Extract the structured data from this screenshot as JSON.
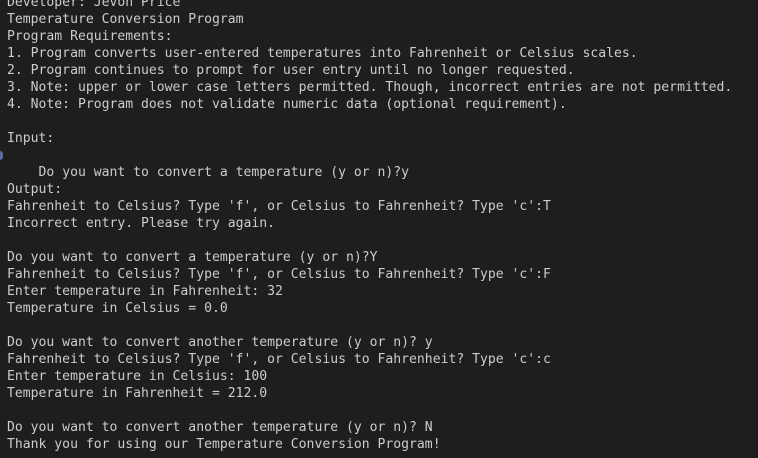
{
  "terminal": {
    "lines": [
      "Developer: Jevon Price",
      "Temperature Conversion Program",
      "Program Requirements:",
      "1. Program converts user-entered temperatures into Fahrenheit or Celsius scales.",
      "2. Program continues to prompt for user entry until no longer requested.",
      "3. Note: upper or lower case letters permitted. Though, incorrect entries are not permitted.",
      "4. Note: Program does not validate numeric data (optional requirement).",
      "",
      "Input:",
      "Do you want to convert a temperature (y or n)?y",
      "",
      "Output:",
      "Fahrenheit to Celsius? Type 'f', or Celsius to Fahrenheit? Type 'c':T",
      "Incorrect entry. Please try again.",
      "",
      "Do you want to convert a temperature (y or n)?Y",
      "Fahrenheit to Celsius? Type 'f', or Celsius to Fahrenheit? Type 'c':F",
      "Enter temperature in Fahrenheit: 32",
      "Temperature in Celsius = 0.0",
      "",
      "Do you want to convert another temperature (y or n)? y",
      "Fahrenheit to Celsius? Type 'f', or Celsius to Fahrenheit? Type 'c':c",
      "Enter temperature in Celsius: 100",
      "Temperature in Fahrenheit = 212.0",
      "",
      "Do you want to convert another temperature (y or n)? N",
      "Thank you for using our Temperature Conversion Program!"
    ]
  },
  "colors": {
    "background": "#1e1e1e",
    "text": "#cccccc",
    "marker": "#5c6ea0"
  }
}
